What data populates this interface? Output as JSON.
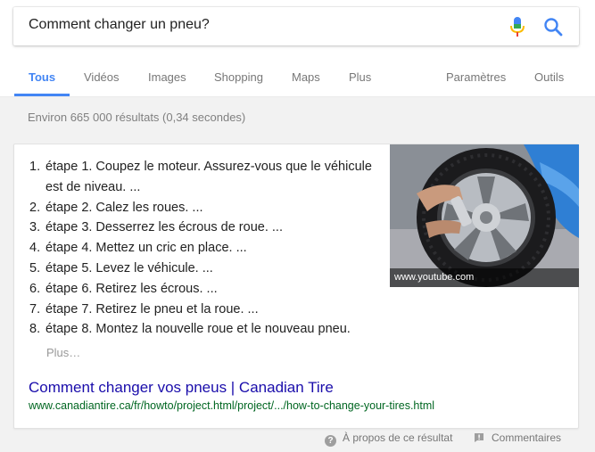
{
  "search": {
    "query": "Comment changer un pneu?",
    "mic_icon": "microphone-icon",
    "search_icon": "search-icon"
  },
  "tabs": [
    {
      "label": "Tous",
      "active": true
    },
    {
      "label": "Vidéos",
      "active": false
    },
    {
      "label": "Images",
      "active": false
    },
    {
      "label": "Shopping",
      "active": false
    },
    {
      "label": "Maps",
      "active": false
    },
    {
      "label": "Plus",
      "active": false
    },
    {
      "label": "Paramètres",
      "active": false
    },
    {
      "label": "Outils",
      "active": false
    }
  ],
  "stats": "Environ 665 000 résultats (0,34 secondes)",
  "snippet": {
    "steps": [
      {
        "num": "1.",
        "text": "étape 1. Coupez le moteur. Assurez-vous que le véhicule est de niveau. ..."
      },
      {
        "num": "2.",
        "text": "étape 2. Calez les roues. ..."
      },
      {
        "num": "3.",
        "text": "étape 3. Desserrez les écrous de roue. ..."
      },
      {
        "num": "4.",
        "text": "étape 4. Mettez un cric en place. ..."
      },
      {
        "num": "5.",
        "text": "étape 5. Levez le véhicule. ..."
      },
      {
        "num": "6.",
        "text": "étape 6. Retirez les écrous. ..."
      },
      {
        "num": "7.",
        "text": "étape 7. Retirez le pneu et la roue. ..."
      },
      {
        "num": "8.",
        "text": "étape 8. Montez la nouvelle roue et le nouveau pneu."
      }
    ],
    "more": "Plus…",
    "thumbnail_caption": "www.youtube.com",
    "title": "Comment changer vos pneus | Canadian Tire",
    "url": "www.canadiantire.ca/fr/howto/project.html/project/.../how-to-change-your-tires.html"
  },
  "footer": {
    "about": "À propos de ce résultat",
    "about_icon": "question-icon",
    "comments": "Commentaires",
    "comments_icon": "feedback-icon"
  },
  "colors": {
    "accent": "#4285f4",
    "link": "#1a0dab",
    "url": "#006621"
  }
}
